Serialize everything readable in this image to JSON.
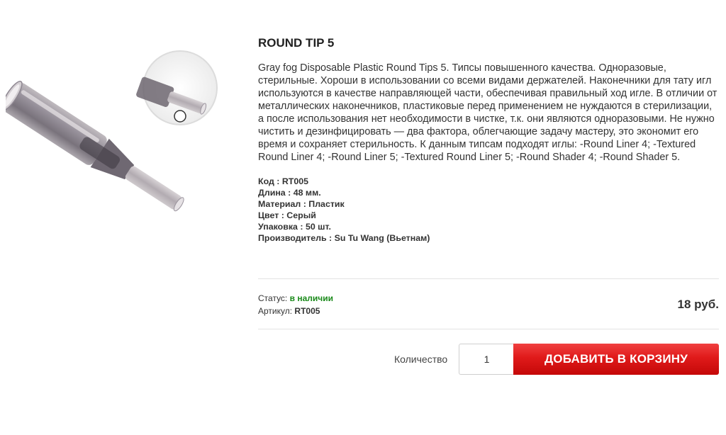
{
  "product": {
    "title": "ROUND TIP 5",
    "description": "Gray fog Disposable Plastic Round Tips 5. Типсы повышенного качества. Одноразовые, стерильные. Хороши в использовании со всеми видами держателей. Наконечники для тату игл используются в качестве направляющей части, обеспечивая правильный ход игле. В отличии от металлических наконечников, пластиковые перед применением не нуждаются в стерилизации, а после использования нет необходимости в чистке, т.к. они являются одноразовыми. Не нужно чистить и дезинфицировать — два фактора, облегчающие задачу мастеру, это экономит его время и сохраняет стерильность. К данным типсам подходят иглы: -Round Liner 4; -Textured Round Liner 4; -Round Liner 5; -Textured Round Liner 5; -Round Shader 4; -Round Shader 5.",
    "specs": [
      "Код : RT005",
      "Длина : 48 мм.",
      "Материал : Пластик",
      "Цвет : Серый",
      "Упаковка : 50 шт.",
      "Производитель : Su Tu Wang (Вьетнам)"
    ],
    "image_icon": "tattoo-tip-image"
  },
  "purchase": {
    "status_label": "Статус:",
    "status_value": "в наличии",
    "sku_label": "Артикул:",
    "sku_value": "RT005",
    "price": "18 руб.",
    "quantity_label": "Количество",
    "quantity_value": "1",
    "add_to_cart_label": "ДОБАВИТЬ В КОРЗИНУ"
  },
  "colors": {
    "in_stock": "#1a8a1a",
    "button_red": "#e01a1a",
    "divider": "#e3e3e3"
  }
}
